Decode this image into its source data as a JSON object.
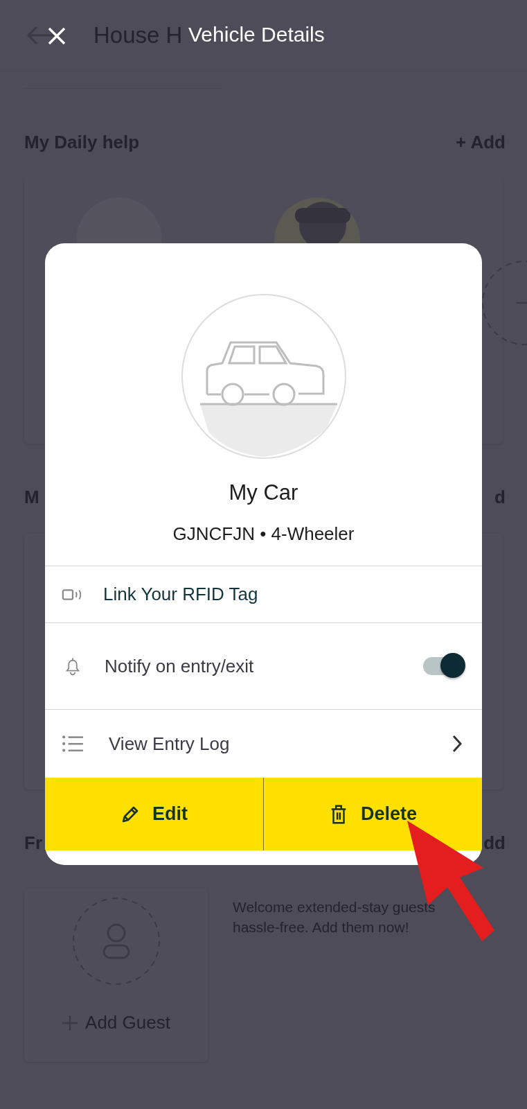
{
  "background": {
    "back_title": "House H",
    "sections": [
      {
        "kind": "helpers",
        "title": "My Daily help",
        "action": "+ Add"
      },
      {
        "kind": "plain",
        "title": "M",
        "action": "d"
      },
      {
        "kind": "guests",
        "title": "Fr",
        "action": "dd"
      }
    ],
    "guest": {
      "add_label": "Add Guest",
      "message": "Welcome extended-stay guests hassle-free. Add them now!"
    }
  },
  "dialog": {
    "title": "Vehicle Details",
    "vehicle": {
      "name": "My Car",
      "details": "GJNCFJN • 4-Wheeler"
    },
    "rows": [
      {
        "kind": "link",
        "label": "Link Your RFID Tag"
      },
      {
        "kind": "toggle",
        "label": "Notify on entry/exit",
        "on": true
      },
      {
        "kind": "nav",
        "label": "View Entry Log"
      }
    ],
    "buttons": [
      {
        "kind": "edit",
        "label": "Edit"
      },
      {
        "kind": "delete",
        "label": "Delete"
      }
    ]
  }
}
